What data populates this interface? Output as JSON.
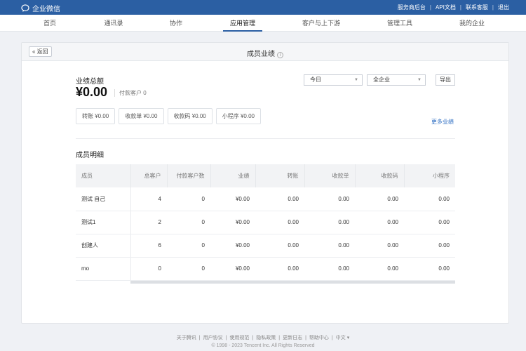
{
  "topbar": {
    "brand": "企业微信",
    "links": [
      "服务商后台",
      "API文档",
      "联系客服",
      "退出"
    ]
  },
  "nav": {
    "items": [
      "首页",
      "通讯录",
      "协作",
      "应用管理",
      "客户与上下游",
      "管理工具",
      "我的企业"
    ],
    "active_index": 3
  },
  "page": {
    "back_label": "« 返回",
    "title": "成员业绩",
    "info_glyph": "i"
  },
  "summary": {
    "label": "业绩总额",
    "amount": "¥0.00",
    "paid_customers": "付款客户 0"
  },
  "filters": {
    "period": "今日",
    "scope": "全企业",
    "caret": "▼",
    "export_label": "导出"
  },
  "chips": [
    "转账 ¥0.00",
    "收款单 ¥0.00",
    "收款码 ¥0.00",
    "小程序 ¥0.00"
  ],
  "more_link": "更多业绩",
  "detail": {
    "title": "成员明细",
    "columns": [
      "成员",
      "总客户",
      "付款客户数",
      "业绩",
      "转账",
      "收款单",
      "收款码",
      "小程序"
    ],
    "rows": [
      [
        "测试 自己",
        "4",
        "0",
        "¥0.00",
        "0.00",
        "0.00",
        "0.00",
        "0.00"
      ],
      [
        "测试1",
        "2",
        "0",
        "¥0.00",
        "0.00",
        "0.00",
        "0.00",
        "0.00"
      ],
      [
        "创建人",
        "6",
        "0",
        "¥0.00",
        "0.00",
        "0.00",
        "0.00",
        "0.00"
      ],
      [
        "mo",
        "0",
        "0",
        "¥0.00",
        "0.00",
        "0.00",
        "0.00",
        "0.00"
      ]
    ]
  },
  "footer": {
    "links": [
      "关于腾讯",
      "用户协议",
      "使用规范",
      "隐私政策",
      "更新日志",
      "帮助中心",
      "中文 ▾"
    ],
    "copyright": "© 1998 - 2023 Tencent Inc. All Rights Reserved"
  },
  "colors": {
    "topbar": "#2b5fa3",
    "link": "#2b6cc2",
    "background": "#eff1f5"
  }
}
